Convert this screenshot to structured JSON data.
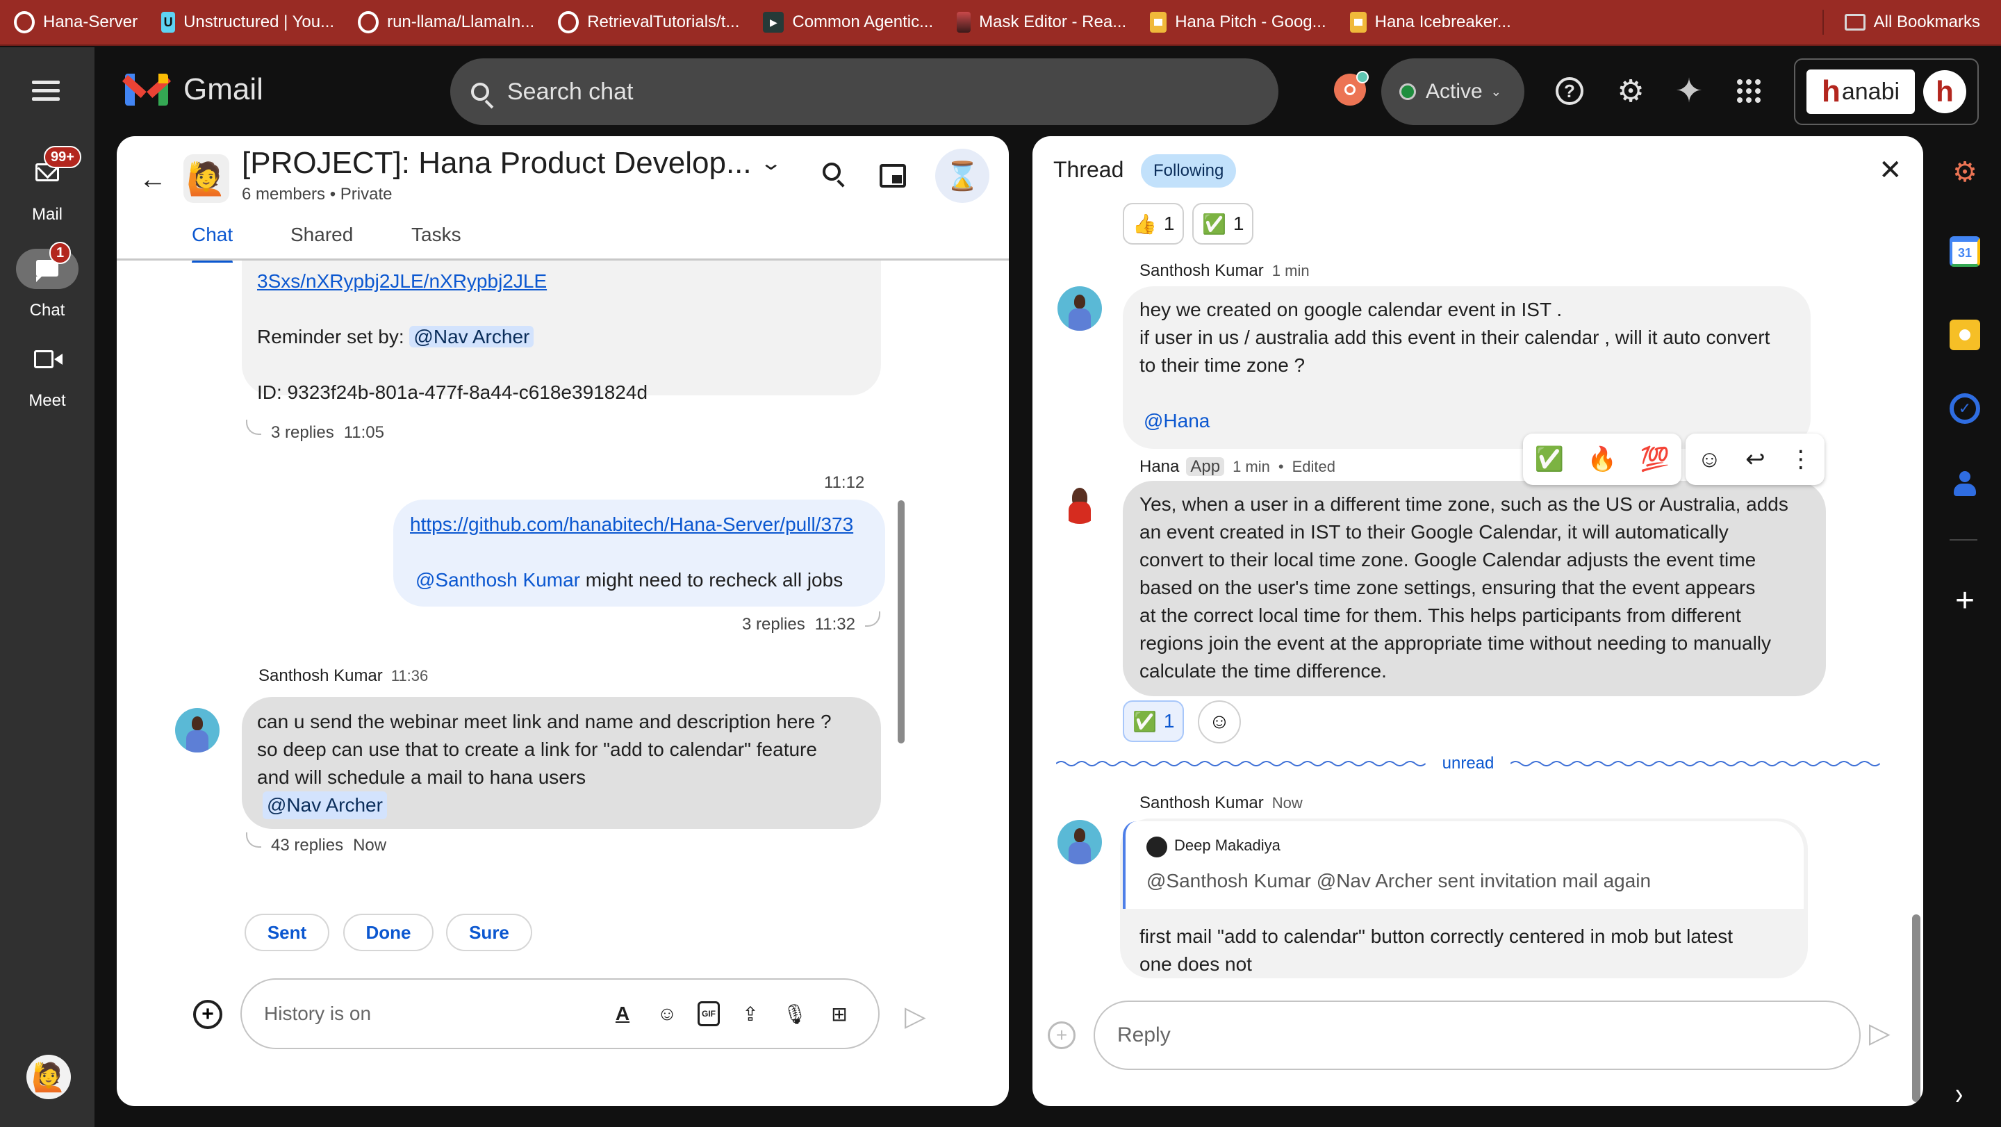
{
  "bookmarks": {
    "items": [
      {
        "label": "Hana-Server",
        "icon": "github-icon"
      },
      {
        "label": "Unstructured | You...",
        "icon": "unstructured-icon"
      },
      {
        "label": "run-llama/LlamaIn...",
        "icon": "github-icon"
      },
      {
        "label": "RetrievalTutorials/t...",
        "icon": "github-icon"
      },
      {
        "label": "Common Agentic...",
        "icon": "webinar-icon"
      },
      {
        "label": "Mask Editor - Rea...",
        "icon": "image-icon"
      },
      {
        "label": "Hana Pitch - Goog...",
        "icon": "slides-icon"
      },
      {
        "label": "Hana Icebreaker...",
        "icon": "slides-icon"
      }
    ],
    "all_bookmarks": "All Bookmarks"
  },
  "rail": {
    "items": [
      {
        "label": "Mail",
        "badge": "99+"
      },
      {
        "label": "Chat",
        "badge": "1"
      },
      {
        "label": "Meet",
        "badge": ""
      }
    ]
  },
  "header": {
    "app_name": "Gmail",
    "search_placeholder": "Search chat",
    "status": "Active",
    "account_brand": "anabi",
    "account_brand_initial": "h",
    "account_avatar_initial": "h"
  },
  "space": {
    "title": "[PROJECT]: Hana Product Develop...",
    "members": "6 members",
    "visibility": "Private",
    "avatar_emoji": "🙋",
    "tabs": [
      "Chat",
      "Shared",
      "Tasks"
    ],
    "active_tab": "Chat"
  },
  "messages": [
    {
      "id": "reminder",
      "link_tail": "3Sxs/nXRypbj2JLE/nXRypbj2JLE",
      "reminder_label": "Reminder set by:",
      "reminder_mention": "@Nav Archer",
      "id_line": "ID: 9323f24b-801a-477f-8a44-c618e391824d",
      "replies": "3 replies",
      "time": "11:05"
    },
    {
      "id": "pr-link",
      "time_header": "11:12",
      "link": "https://github.com/hanabitech/Hana-Server/pull/373",
      "mention": "@Santhosh Kumar",
      "text": " might need to recheck all jobs",
      "replies": "3 replies",
      "time": "11:32"
    },
    {
      "id": "webinar-request",
      "sender": "Santhosh Kumar",
      "time_header": "11:36",
      "lines": [
        "can u send the webinar meet link and name and description  here  ?",
        "so deep can use that to create a link for \"add to calendar\" feature",
        "and will schedule a mail to hana users"
      ],
      "mention": "@Nav Archer",
      "replies": "43 replies",
      "time": "Now"
    }
  ],
  "smart_replies": [
    "Sent",
    "Done",
    "Sure"
  ],
  "compose": {
    "placeholder": "History is on",
    "tools": [
      "format-icon",
      "emoji-icon",
      "gif-icon",
      "upload-icon",
      "mic-icon",
      "video-add-icon"
    ]
  },
  "thread": {
    "title": "Thread",
    "follow_state": "Following",
    "top_reactions": [
      {
        "emoji": "👍",
        "count": "1"
      },
      {
        "emoji": "✅",
        "count": "1"
      }
    ],
    "messages": [
      {
        "sender": "Santhosh Kumar",
        "time": "1 min",
        "lines": [
          "hey we created on google calendar event in IST .",
          "if user in us / australia add this event in their calendar , will it auto convert",
          "to their time zone ?"
        ],
        "mention": "@Hana"
      },
      {
        "sender": "Hana",
        "tag": "App",
        "time": "1 min",
        "edited": "Edited",
        "lines": [
          "Yes, when a user in a different time zone, such as the US or Australia, adds",
          "an event created in IST to their Google Calendar, it will automatically",
          "convert to their local time zone. Google Calendar adjusts the event time",
          "based on the user's time zone settings, ensuring that the event appears",
          "at the correct local time for them. This helps participants from different",
          "regions join the event at the appropriate time without needing to manually",
          "calculate the time difference."
        ],
        "reaction": {
          "emoji": "✅",
          "count": "1"
        },
        "hover_reactions": [
          "✅",
          "🔥",
          "💯"
        ]
      },
      {
        "sender": "Santhosh Kumar",
        "time": "Now",
        "quote_author": "Deep Makadiya",
        "quote_text": "@Santhosh Kumar @Nav Archer sent invitation mail again",
        "lines": [
          "first mail \"add to calendar\" button correctly centered  in mob but latest",
          "one does not"
        ]
      }
    ],
    "unread_label": "unread",
    "reply_placeholder": "Reply"
  },
  "side_apps": [
    "HubSpot",
    "Calendar",
    "Keep",
    "Tasks",
    "Contacts"
  ],
  "calendar_day": "31",
  "colors": {
    "bookmark_bar": "#992b24",
    "accent": "#0b57d0",
    "badge": "#b3261e",
    "following_chip": "#c2e1fb",
    "mention_bg": "#d3e3fd",
    "status_active": "#1e8e3e"
  }
}
